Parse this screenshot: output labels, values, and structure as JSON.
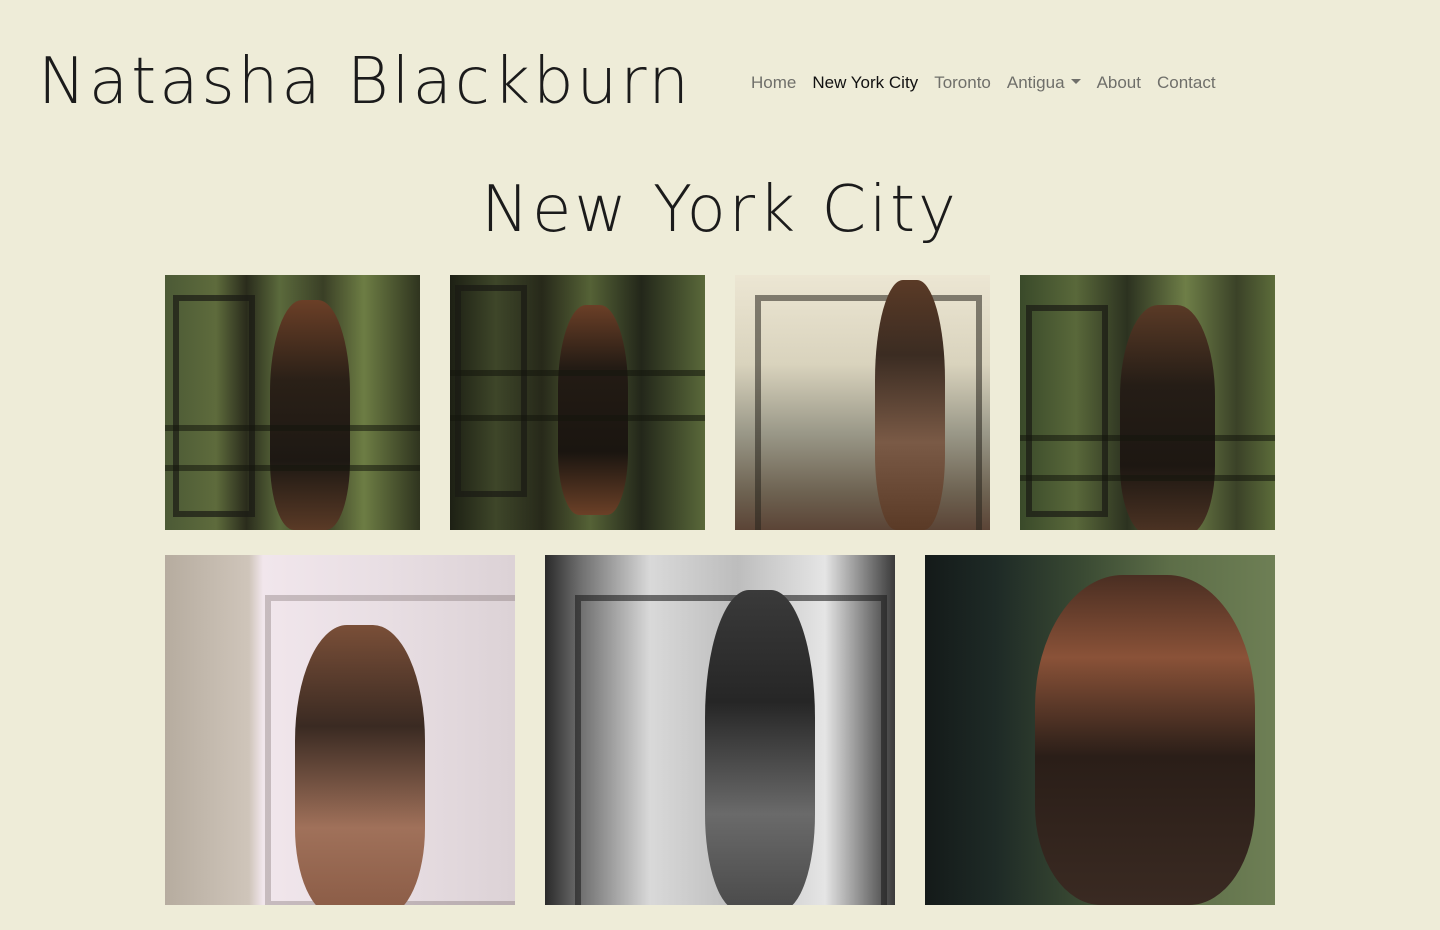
{
  "brand": {
    "name": "Natasha Blackburn"
  },
  "nav": {
    "items": [
      {
        "label": "Home",
        "active": false
      },
      {
        "label": "New York City",
        "active": true
      },
      {
        "label": "Toronto",
        "active": false
      },
      {
        "label": "Antigua",
        "active": false,
        "dropdown": true
      },
      {
        "label": "About",
        "active": false
      },
      {
        "label": "Contact",
        "active": false
      }
    ]
  },
  "page": {
    "title": "New York City"
  },
  "gallery": {
    "rows": [
      {
        "photos": [
          "photo-1",
          "photo-2",
          "photo-3",
          "photo-4"
        ]
      },
      {
        "photos": [
          "photo-5",
          "photo-6",
          "photo-7"
        ]
      }
    ]
  },
  "colors": {
    "background": "#eeecd8",
    "text": "#1b1b1b",
    "nav_inactive": "#6f6f6a"
  }
}
